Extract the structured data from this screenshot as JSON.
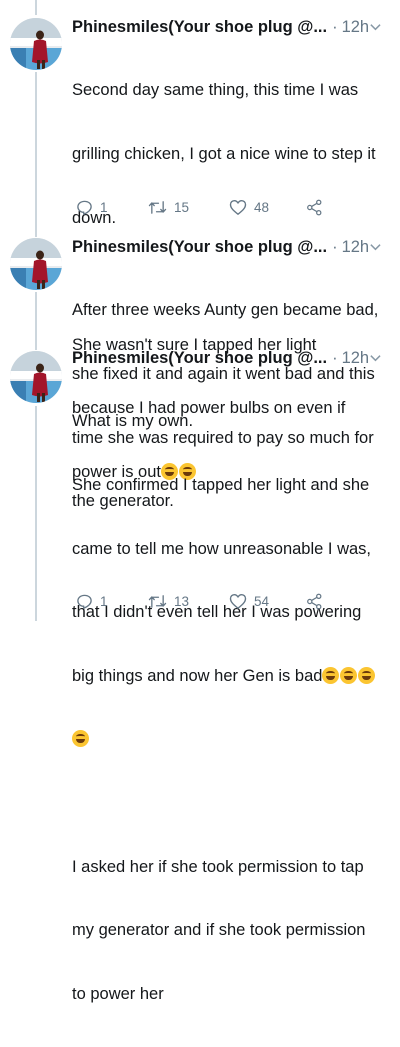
{
  "tweets": [
    {
      "author": "Phinesmiles(Your shoe plug @...",
      "separator": "·",
      "time": "12h",
      "lines": [
        "Second day same thing, this time I was",
        "grilling chicken, I got a nice wine to step it",
        "down.",
        "",
        "She wasn't sure I tapped her light",
        "because I had power bulbs on even if",
        "power is out"
      ],
      "emoji": "🤣🤣",
      "stats": {
        "replies": "1",
        "retweets": "15",
        "likes": "48"
      }
    },
    {
      "author": "Phinesmiles(Your shoe plug @...",
      "separator": "·",
      "time": "12h",
      "lines": [
        "After three weeks Aunty gen became bad,",
        "she fixed it and again it went bad and this",
        "time she was required to pay so much for",
        "the generator."
      ]
    },
    {
      "author": "Phinesmiles(Your shoe plug @...",
      "separator": "·",
      "time": "12h",
      "lines": [
        "What is my own.",
        "She confirmed I tapped her light and she",
        "came to tell me how unreasonable I was,",
        "that I didn't even tell her I was powering",
        "big things and now her Gen is bad"
      ],
      "emoji_inline": "🤣🤣🤣",
      "emoji_line": "🤣",
      "lines_after": [
        "",
        "I asked her if she took permission to tap",
        "my generator and if she took permission",
        "to power her"
      ],
      "stats": {
        "replies": "1",
        "retweets": "13",
        "likes": "54"
      }
    }
  ],
  "colors": {
    "text": "#14171a",
    "muted": "#657786",
    "thread_line": "#ccd6dd"
  },
  "icons": [
    "reply-icon",
    "retweet-icon",
    "like-icon",
    "share-icon",
    "chevron-down-icon"
  ]
}
